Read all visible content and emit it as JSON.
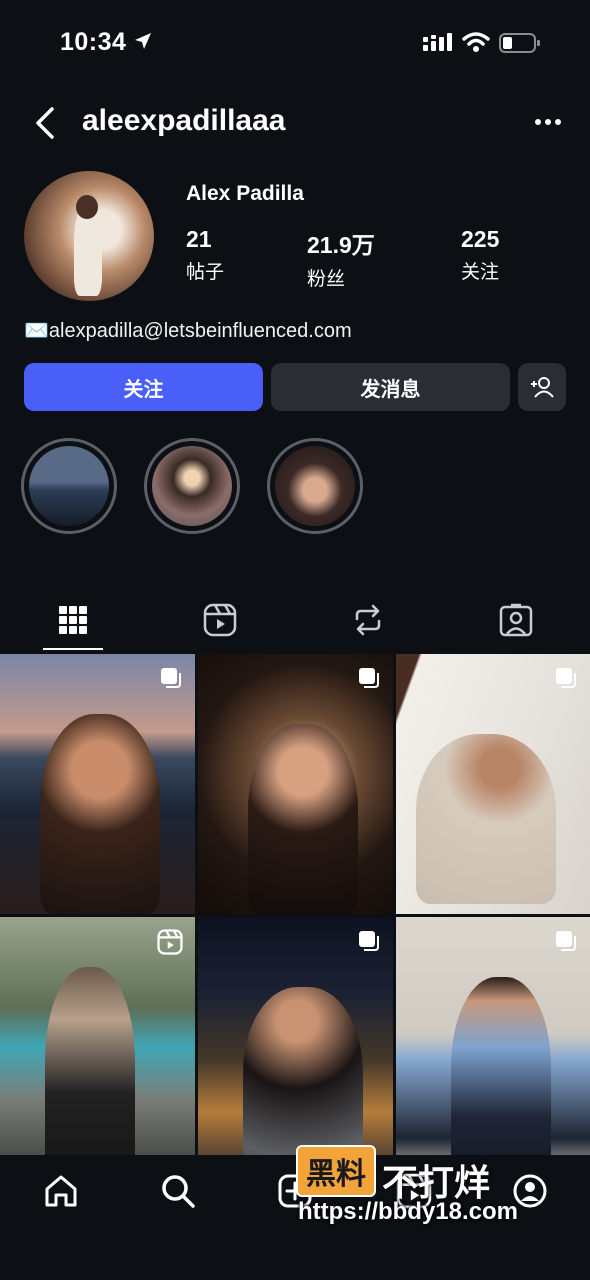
{
  "status_bar": {
    "time": "10:34"
  },
  "header": {
    "username": "aleexpadillaaa"
  },
  "profile": {
    "display_name": "Alex Padilla",
    "stats": [
      {
        "value": "21",
        "label": "帖子"
      },
      {
        "value": "21.9万",
        "label": "粉丝"
      },
      {
        "value": "225",
        "label": "关注"
      }
    ],
    "bio": "✉️alexpadilla@letsbeinfluenced.com"
  },
  "actions": {
    "follow_label": "关注",
    "message_label": "发消息"
  },
  "tabs": [
    "grid-icon",
    "reels-icon",
    "reposts-icon",
    "tagged-icon"
  ],
  "colors": {
    "follow_button": "#4a5ff8",
    "secondary_button": "#2a2d33",
    "background": "#0c0f14"
  },
  "watermark": {
    "badge": "黑料",
    "text": "不打烊",
    "url": "https://bbdy18.com"
  }
}
